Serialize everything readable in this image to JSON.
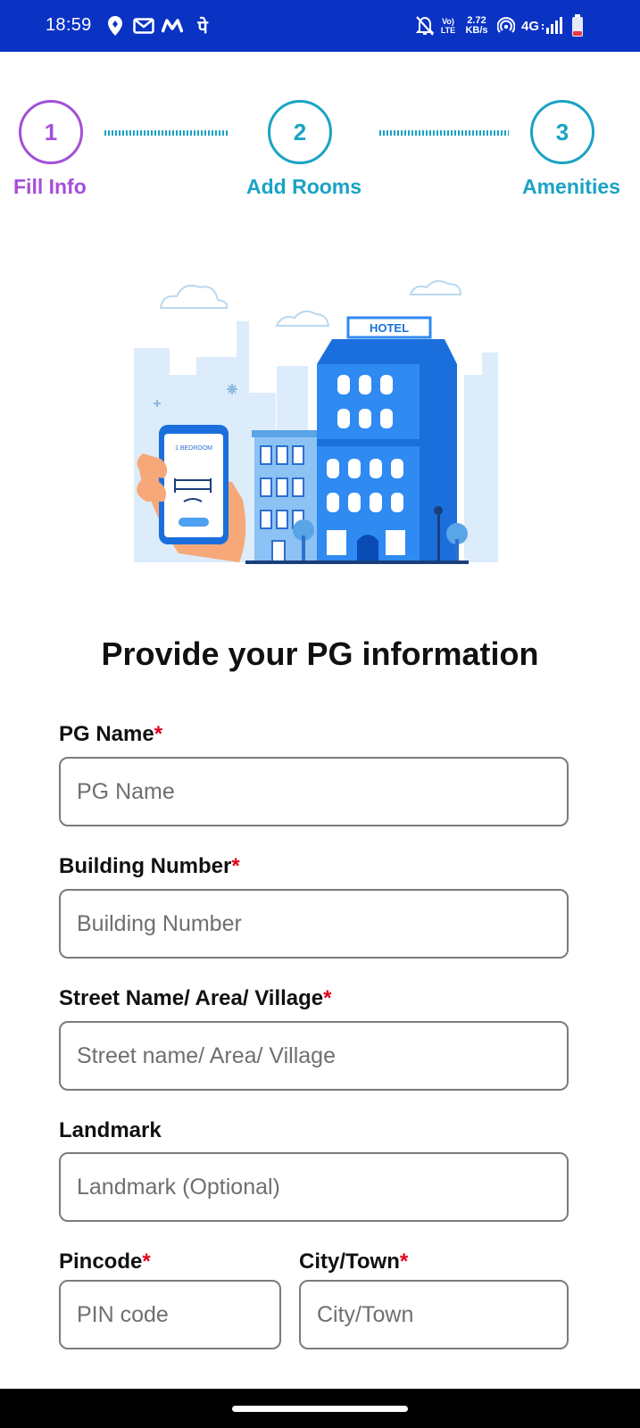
{
  "status_bar": {
    "time": "18:59",
    "deva_glyph": "पे",
    "volte_line1": "Vo)",
    "volte_line2": "LTE",
    "speed_line1": "2.72",
    "speed_line2": "KB/s",
    "network_type": "4G",
    "icons": [
      "location-pin-icon",
      "gmail-icon",
      "m-app-icon",
      "deva-app-icon",
      "mute-notification-icon",
      "volte-icon",
      "hotspot-icon",
      "signal-icon",
      "battery-icon"
    ],
    "background_color": "#0a33c4"
  },
  "stepper": {
    "steps": [
      {
        "number": "1",
        "label": "Fill Info",
        "active": true
      },
      {
        "number": "2",
        "label": "Add Rooms",
        "active": false
      },
      {
        "number": "3",
        "label": "Amenities",
        "active": false
      }
    ],
    "active_color": "#a44fd8",
    "inactive_color": "#1aa3c4"
  },
  "illustration": {
    "hotel_sign": "HOTEL",
    "phone_screen_text": "1 BEDROOM"
  },
  "heading": "Provide your PG information",
  "form": {
    "required_marker": "*",
    "fields": [
      {
        "label": "PG Name",
        "required": true,
        "placeholder": "PG Name",
        "value": ""
      },
      {
        "label": "Building Number",
        "required": true,
        "placeholder": "Building Number",
        "value": ""
      },
      {
        "label": "Street Name/ Area/ Village",
        "required": true,
        "placeholder": "Street name/ Area/ Village",
        "value": ""
      },
      {
        "label": "Landmark",
        "required": false,
        "placeholder": "Landmark (Optional)",
        "value": ""
      },
      {
        "label": "Pincode",
        "required": true,
        "placeholder": "PIN code",
        "value": ""
      },
      {
        "label": "City/Town",
        "required": true,
        "placeholder": "City/Town",
        "value": ""
      }
    ],
    "required_color": "#e0001b"
  }
}
